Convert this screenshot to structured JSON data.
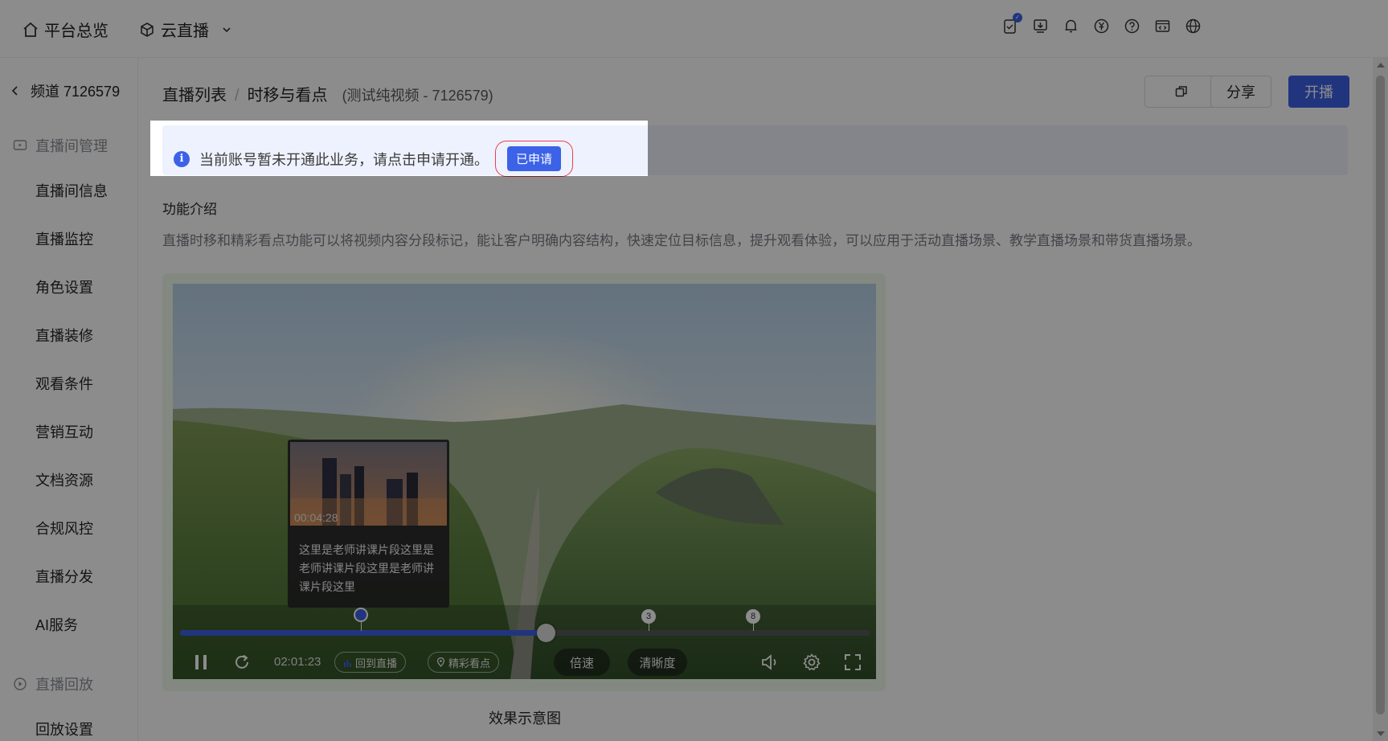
{
  "topbar": {
    "overview_label": "平台总览",
    "product_label": "云直播",
    "icons": [
      "task-check-icon",
      "download-icon",
      "bell-icon",
      "yuan-icon",
      "help-icon",
      "code-window-icon",
      "globe-icon"
    ]
  },
  "sidebar": {
    "channel_label": "频道 7126579",
    "group1_label": "直播间管理",
    "items": [
      "直播间信息",
      "直播监控",
      "角色设置",
      "直播装修",
      "观看条件",
      "营销互动",
      "文档资源",
      "合规风控",
      "直播分发",
      "AI服务"
    ],
    "group2_label": "直播回放",
    "replay_item": "回放设置"
  },
  "header": {
    "crumb_root": "直播列表",
    "crumb_sep": "/",
    "crumb_current": "时移与看点",
    "crumb_sub": "(测试纯视频 - 7126579)",
    "share_label": "分享",
    "live_label": "开播"
  },
  "notice": {
    "text": "当前账号暂未开通此业务，请点击申请开通。",
    "button_label": "已申请"
  },
  "intro": {
    "title": "功能介绍",
    "description": "直播时移和精彩看点功能可以将视频内容分段标记，能让客户明确内容结构，快速定位目标信息，提升观看体验，可以应用于活动直播场景、教学直播场景和带货直播场景。"
  },
  "player": {
    "preview_time": "00:04:28",
    "preview_text": "这里是老师讲课片段这里是老师讲课片段这里是老师讲课片段这里",
    "current_time": "02:01:23",
    "back_live_label": "回到直播",
    "highlights_label": "精彩看点",
    "speed_label": "倍速",
    "quality_label": "清晰度",
    "progress": 0.53,
    "markers": [
      "3",
      "8"
    ]
  },
  "caption": "效果示意图",
  "colors": {
    "accent": "#3c62e8",
    "notice_bg": "#eef2fe",
    "highlight_border": "#e8404a"
  }
}
